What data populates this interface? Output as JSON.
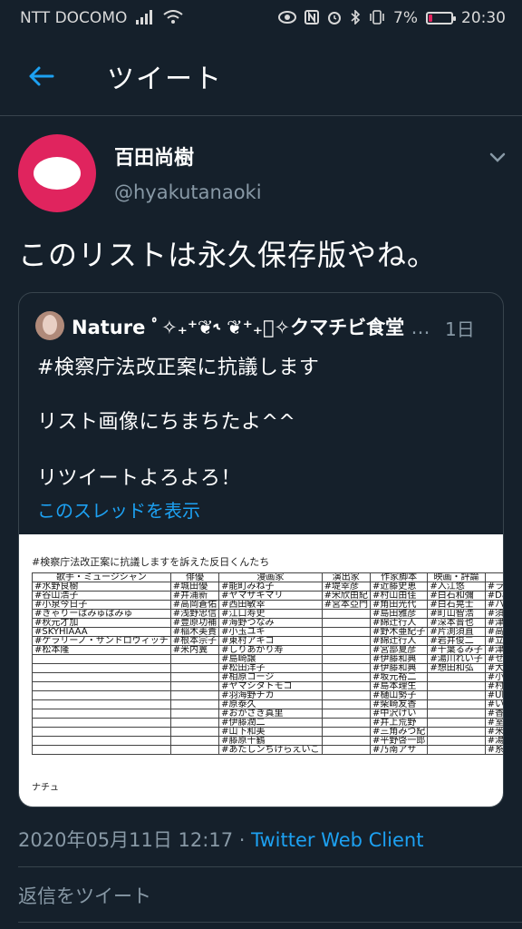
{
  "status_bar": {
    "carrier": "NTT DOCOMO",
    "battery_percent": "7%",
    "time": "20:30",
    "icons": [
      "signal-icon",
      "wifi-icon",
      "eye-icon",
      "nfc-icon",
      "alarm-icon",
      "bluetooth-icon",
      "vibrate-icon",
      "battery-icon"
    ]
  },
  "header": {
    "title": "ツイート"
  },
  "tweet": {
    "name": "百田尚樹",
    "handle": "@hyakutanaoki",
    "text": "このリストは永久保存版やね。",
    "timestamp": "2020年05月11日 12:17 · ",
    "client": "Twitter Web Client"
  },
  "quote": {
    "name": "Nature ﾟ✧₊⁺❦˞ ❦⁺₊ﾟ✧クマチビ食堂",
    "ellipsis": "…",
    "time": "1日",
    "lines": [
      "#検察庁法改正案に抗議します",
      "リスト画像にちまちたよ^^",
      "リツイートよろよろ！"
    ],
    "thread_link": "このスレッドを表示",
    "image": {
      "title": "#検察庁法改正案に抗議しますを訴えた反日くんたち",
      "headers": [
        "歌手・ミュージシャン",
        "俳優",
        "漫画家",
        "演出家",
        "作家脚本",
        "映画・評論",
        ""
      ],
      "columns": [
        [
          "#水野良樹",
          "#谷山浩子",
          "#小泉今日子",
          "#きゃりーぱみゅぱみゅ",
          "#秋元才加",
          "#SKYHIAAA",
          "#ケラリーノ・サンドロヴィッチ",
          "#松本隆"
        ],
        [
          "#城田優",
          "#井浦新",
          "#高岡蒼佑",
          "#浅野忠信",
          "#豊原功補",
          "#稲木美貴",
          "#根本宗子",
          "#米内翼"
        ],
        [
          "#能町みね子",
          "#ヤマザキマリ",
          "#西田敏幸",
          "#江口寿史",
          "#海野つなみ",
          "#小玉ユキ",
          "#東村アキコ",
          "#しりあがり寿",
          "#島崎譲",
          "#松田洋子",
          "#相原コージ",
          "#ヤマシタトモコ",
          "#羽海野チカ",
          "#原泰久",
          "#おかざき真里",
          "#伊藤潤二",
          "#山下和美",
          "#藤原千鶴",
          "#あたしンちけらえいこ"
        ],
        [
          "#堤幸彦",
          "#宋欣由紀",
          "#宮本亞門"
        ],
        [
          "#近藤史恵",
          "#村山由佳",
          "#角田光代",
          "#島田雅彦",
          "#綿辻行人",
          "#野木亜紀子",
          "#綿辻行人",
          "#宮部夏彦",
          "#伊藤和典",
          "#伊藤和典",
          "#坂元裕二",
          "#島本理生",
          "#樋山勢子",
          "#柴崎友香",
          "#中沢けい",
          "#井上荒野",
          "#三角みづ紀",
          "#平野啓一郎",
          "#乃南アサ"
        ],
        [
          "#入江悠",
          "#白石和彌",
          "#白石晃士",
          "#町山智浩",
          "#深本晋也",
          "#片渕須直",
          "#岩井俊二",
          "#千葉るみ子",
          "#湯川れい子",
          "#想田和弘"
        ],
        [
          "#ラサール",
          "#DaiGo",
          "#ハマカ",
          "#須藤",
          "#津田",
          "#高田",
          "#立川",
          "#津田",
          "#せや",
          "#大久",
          "#小島",
          "#村本",
          "#UNA",
          "#いとう",
          "#香山",
          "#室井",
          "#米山",
          "#湯浅",
          "#糸井"
        ]
      ],
      "footer": "ナチュ"
    }
  },
  "reply": {
    "placeholder": "返信をツイート"
  }
}
